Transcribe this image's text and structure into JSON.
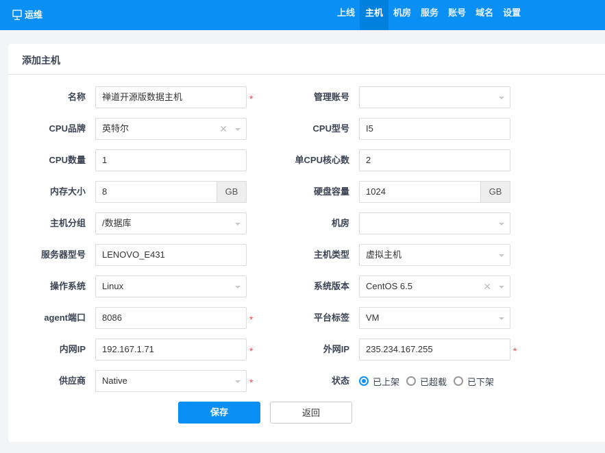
{
  "nav": {
    "brand": "运维",
    "items": [
      {
        "label": "上线"
      },
      {
        "label": "主机",
        "active": true
      },
      {
        "label": "机房"
      },
      {
        "label": "服务"
      },
      {
        "label": "账号"
      },
      {
        "label": "域名"
      },
      {
        "label": "设置"
      }
    ]
  },
  "card": {
    "title": "添加主机"
  },
  "left": [
    {
      "label": "名称",
      "type": "text",
      "value": "禅道开源版数据主机",
      "required": true
    },
    {
      "label": "CPU品牌",
      "type": "select",
      "value": "英特尔",
      "clearable": true
    },
    {
      "label": "CPU数量",
      "type": "text",
      "value": "1"
    },
    {
      "label": "内存大小",
      "type": "unit",
      "value": "8",
      "unit": "GB"
    },
    {
      "label": "主机分组",
      "type": "select",
      "value": "/数据库"
    },
    {
      "label": "服务器型号",
      "type": "text",
      "value": "LENOVO_E431"
    },
    {
      "label": "操作系统",
      "type": "select",
      "value": "Linux"
    },
    {
      "label": "agent端口",
      "type": "text",
      "value": "8086",
      "required": true
    },
    {
      "label": "内网IP",
      "type": "text",
      "value": "192.167.1.71",
      "required": true
    },
    {
      "label": "供应商",
      "type": "select",
      "value": "Native",
      "required": true
    }
  ],
  "right": [
    {
      "label": "管理账号",
      "type": "select",
      "value": ""
    },
    {
      "label": "CPU型号",
      "type": "text",
      "value": "I5"
    },
    {
      "label": "单CPU核心数",
      "type": "text",
      "value": "2"
    },
    {
      "label": "硬盘容量",
      "type": "unit",
      "value": "1024",
      "unit": "GB"
    },
    {
      "label": "机房",
      "type": "select",
      "value": ""
    },
    {
      "label": "主机类型",
      "type": "select",
      "value": "虚拟主机"
    },
    {
      "label": "系统版本",
      "type": "select",
      "value": "CentOS 6.5",
      "clearable": true
    },
    {
      "label": "平台标签",
      "type": "select",
      "value": "VM"
    },
    {
      "label": "外网IP",
      "type": "text",
      "value": "235.234.167.255",
      "required": true
    },
    {
      "label": "状态",
      "type": "radio",
      "options": [
        {
          "label": "已上架",
          "checked": true
        },
        {
          "label": "已超载"
        },
        {
          "label": "已下架"
        }
      ]
    }
  ],
  "buttons": {
    "save": "保存",
    "back": "返回"
  },
  "colors": {
    "primary": "#0a8ff5",
    "navActive": "#0081e0",
    "required": "#f04848"
  }
}
